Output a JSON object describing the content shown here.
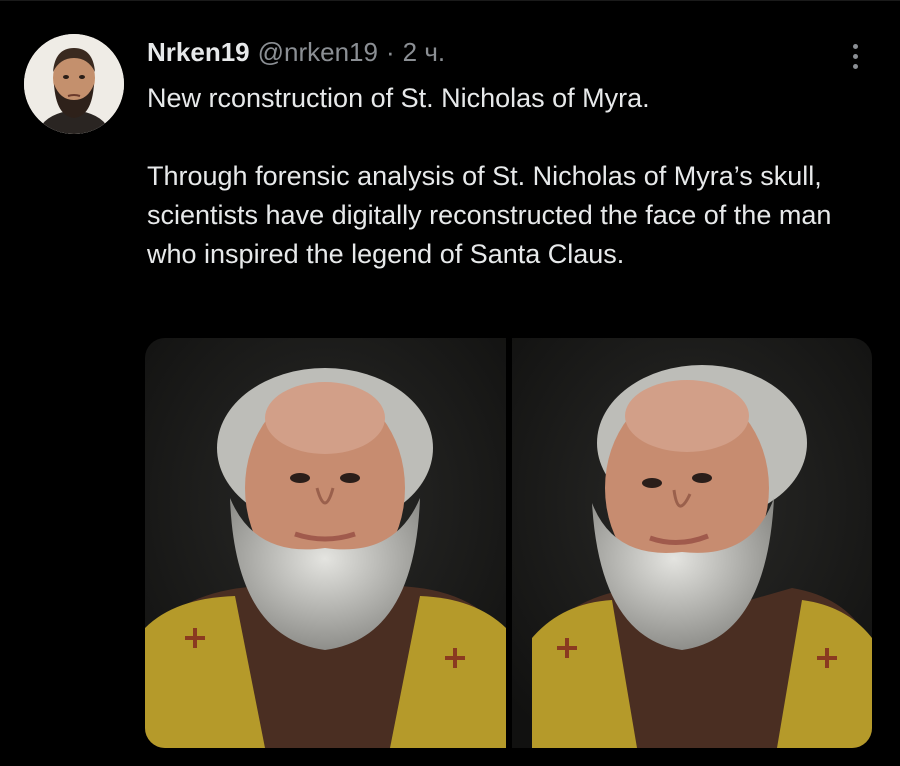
{
  "tweet": {
    "author": {
      "name": "Nrken19",
      "handle": "@nrken19",
      "separator": "·",
      "time": "2 ч.",
      "avatar_icon": "bearded-man-portrait"
    },
    "more_icon": "more-vertical-icon",
    "text_paragraphs": [
      "New rconstruction of St. Nicholas of Myra.",
      "Through forensic analysis of St. Nicholas of Myra’s skull, scientists have digitally reconstructed the face of the man who inspired the legend of Santa Claus."
    ],
    "media": [
      {
        "icon": "reconstructed-face-front-image"
      },
      {
        "icon": "reconstructed-face-three-quarter-image"
      }
    ]
  },
  "colors": {
    "background": "#000000",
    "text_primary": "#e7e9ea",
    "text_secondary": "#8b8f94",
    "vestment_gold": "#b59a2a",
    "robe_brown": "#4a2e22"
  }
}
